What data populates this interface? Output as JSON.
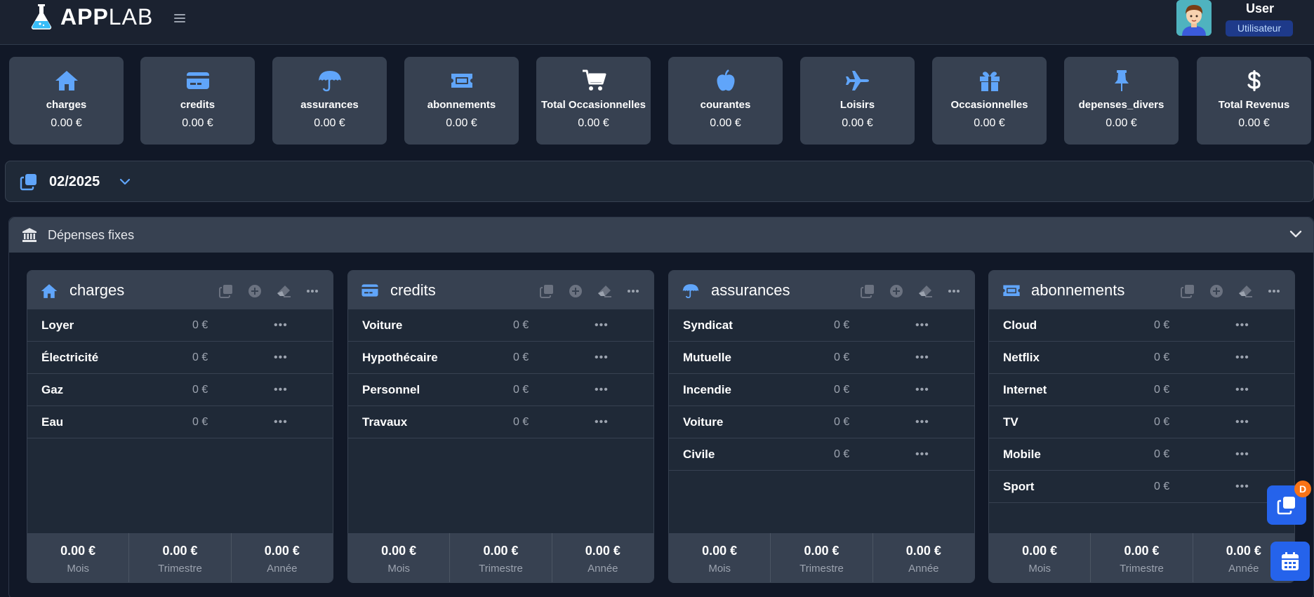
{
  "app": {
    "logo_bold": "APP",
    "logo_thin": "LAB"
  },
  "user": {
    "name": "User",
    "role": "Utilisateur"
  },
  "summary": [
    {
      "label": "charges",
      "value": "0.00 €",
      "icon": "home-icon"
    },
    {
      "label": "credits",
      "value": "0.00 €",
      "icon": "credit-card-icon"
    },
    {
      "label": "assurances",
      "value": "0.00 €",
      "icon": "umbrella-icon"
    },
    {
      "label": "abonnements",
      "value": "0.00 €",
      "icon": "ticket-icon"
    },
    {
      "label": "Total Occasionnelles",
      "value": "0.00 €",
      "icon": "cart-icon"
    },
    {
      "label": "courantes",
      "value": "0.00 €",
      "icon": "apple-icon"
    },
    {
      "label": "Loisirs",
      "value": "0.00 €",
      "icon": "plane-icon"
    },
    {
      "label": "Occasionnelles",
      "value": "0.00 €",
      "icon": "gift-icon"
    },
    {
      "label": "depenses_divers",
      "value": "0.00 €",
      "icon": "pin-icon"
    },
    {
      "label": "Total Revenus",
      "value": "0.00 €",
      "icon": "dollar-icon"
    }
  ],
  "month": {
    "value": "02/2025"
  },
  "section": {
    "title": "Dépenses fixes"
  },
  "categories": [
    {
      "title": "charges",
      "icon": "home-icon",
      "rows": [
        {
          "name": "Loyer",
          "amount": "0 €"
        },
        {
          "name": "Électricité",
          "amount": "0 €"
        },
        {
          "name": "Gaz",
          "amount": "0 €"
        },
        {
          "name": "Eau",
          "amount": "0 €"
        }
      ],
      "footer": [
        {
          "value": "0.00 €",
          "label": "Mois"
        },
        {
          "value": "0.00 €",
          "label": "Trimestre"
        },
        {
          "value": "0.00 €",
          "label": "Année"
        }
      ]
    },
    {
      "title": "credits",
      "icon": "credit-card-icon",
      "rows": [
        {
          "name": "Voiture",
          "amount": "0 €"
        },
        {
          "name": "Hypothécaire",
          "amount": "0 €"
        },
        {
          "name": "Personnel",
          "amount": "0 €"
        },
        {
          "name": "Travaux",
          "amount": "0 €"
        }
      ],
      "footer": [
        {
          "value": "0.00 €",
          "label": "Mois"
        },
        {
          "value": "0.00 €",
          "label": "Trimestre"
        },
        {
          "value": "0.00 €",
          "label": "Année"
        }
      ]
    },
    {
      "title": "assurances",
      "icon": "umbrella-icon",
      "rows": [
        {
          "name": "Syndicat",
          "amount": "0 €"
        },
        {
          "name": "Mutuelle",
          "amount": "0 €"
        },
        {
          "name": "Incendie",
          "amount": "0 €"
        },
        {
          "name": "Voiture",
          "amount": "0 €"
        },
        {
          "name": "Civile",
          "amount": "0 €"
        }
      ],
      "footer": [
        {
          "value": "0.00 €",
          "label": "Mois"
        },
        {
          "value": "0.00 €",
          "label": "Trimestre"
        },
        {
          "value": "0.00 €",
          "label": "Année"
        }
      ]
    },
    {
      "title": "abonnements",
      "icon": "ticket-icon",
      "rows": [
        {
          "name": "Cloud",
          "amount": "0 €"
        },
        {
          "name": "Netflix",
          "amount": "0 €"
        },
        {
          "name": "Internet",
          "amount": "0 €"
        },
        {
          "name": "TV",
          "amount": "0 €"
        },
        {
          "name": "Mobile",
          "amount": "0 €"
        },
        {
          "name": "Sport",
          "amount": "0 €"
        }
      ],
      "footer": [
        {
          "value": "0.00 €",
          "label": "Mois"
        },
        {
          "value": "0.00 €",
          "label": "Trimestre"
        },
        {
          "value": "0.00 €",
          "label": "Année"
        }
      ]
    }
  ],
  "row_menu_glyph": "•••",
  "fab": {
    "badge": "D"
  },
  "colors": {
    "background": "#111827",
    "card": "#374151",
    "accent_blue": "#60a5fa",
    "fab_blue": "#2563eb",
    "badge_orange": "#f97316"
  }
}
